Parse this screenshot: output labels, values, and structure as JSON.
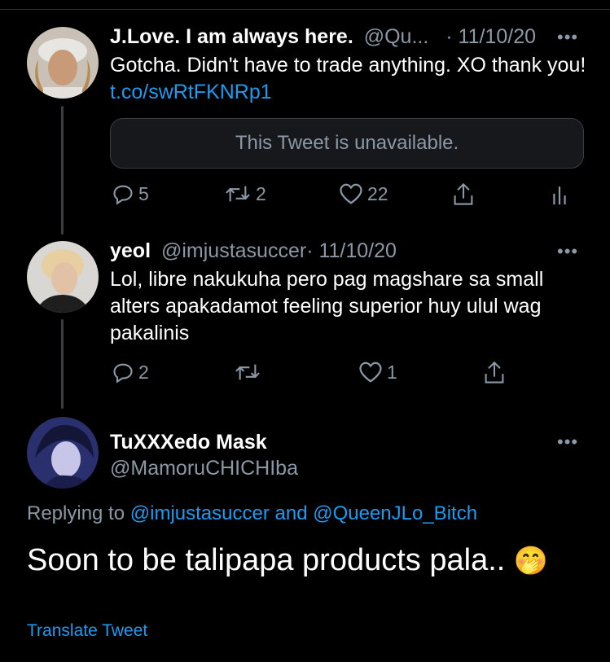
{
  "tweets": [
    {
      "name": "J.Love. I am always here.",
      "handle": "@Qu...",
      "date": "· 11/10/20",
      "text": "Gotcha. Didn't have to trade anything. XO thank you! ",
      "link": "t.co/swRtFKNRp1",
      "quoted": "This Tweet is unavailable.",
      "replies": "5",
      "retweets": "2",
      "likes": "22"
    },
    {
      "name": "yeol",
      "handle": "@imjustasuccer",
      "date": "· 11/10/20",
      "text": "Lol, libre nakukuha pero pag magshare sa small alters apakadamot feeling superior huy ulul wag pakalinis",
      "replies": "2",
      "retweets": "",
      "likes": "1"
    }
  ],
  "main_tweet": {
    "name": "TuXXXedo Mask",
    "handle": "@MamoruCHICHIba",
    "replying_prefix": "Replying to ",
    "replying_user1": "@imjustasuccer",
    "replying_and": " and ",
    "replying_user2": "@QueenJLo_Bitch",
    "text": "Soon to be talipapa products pala.. ",
    "emoji": "🤭",
    "translate": "Translate Tweet"
  },
  "more_glyph": "•••",
  "colors": {
    "background": "#000000",
    "link": "#1d9bf0",
    "muted": "#8b98a5",
    "divider": "#2f3336"
  }
}
